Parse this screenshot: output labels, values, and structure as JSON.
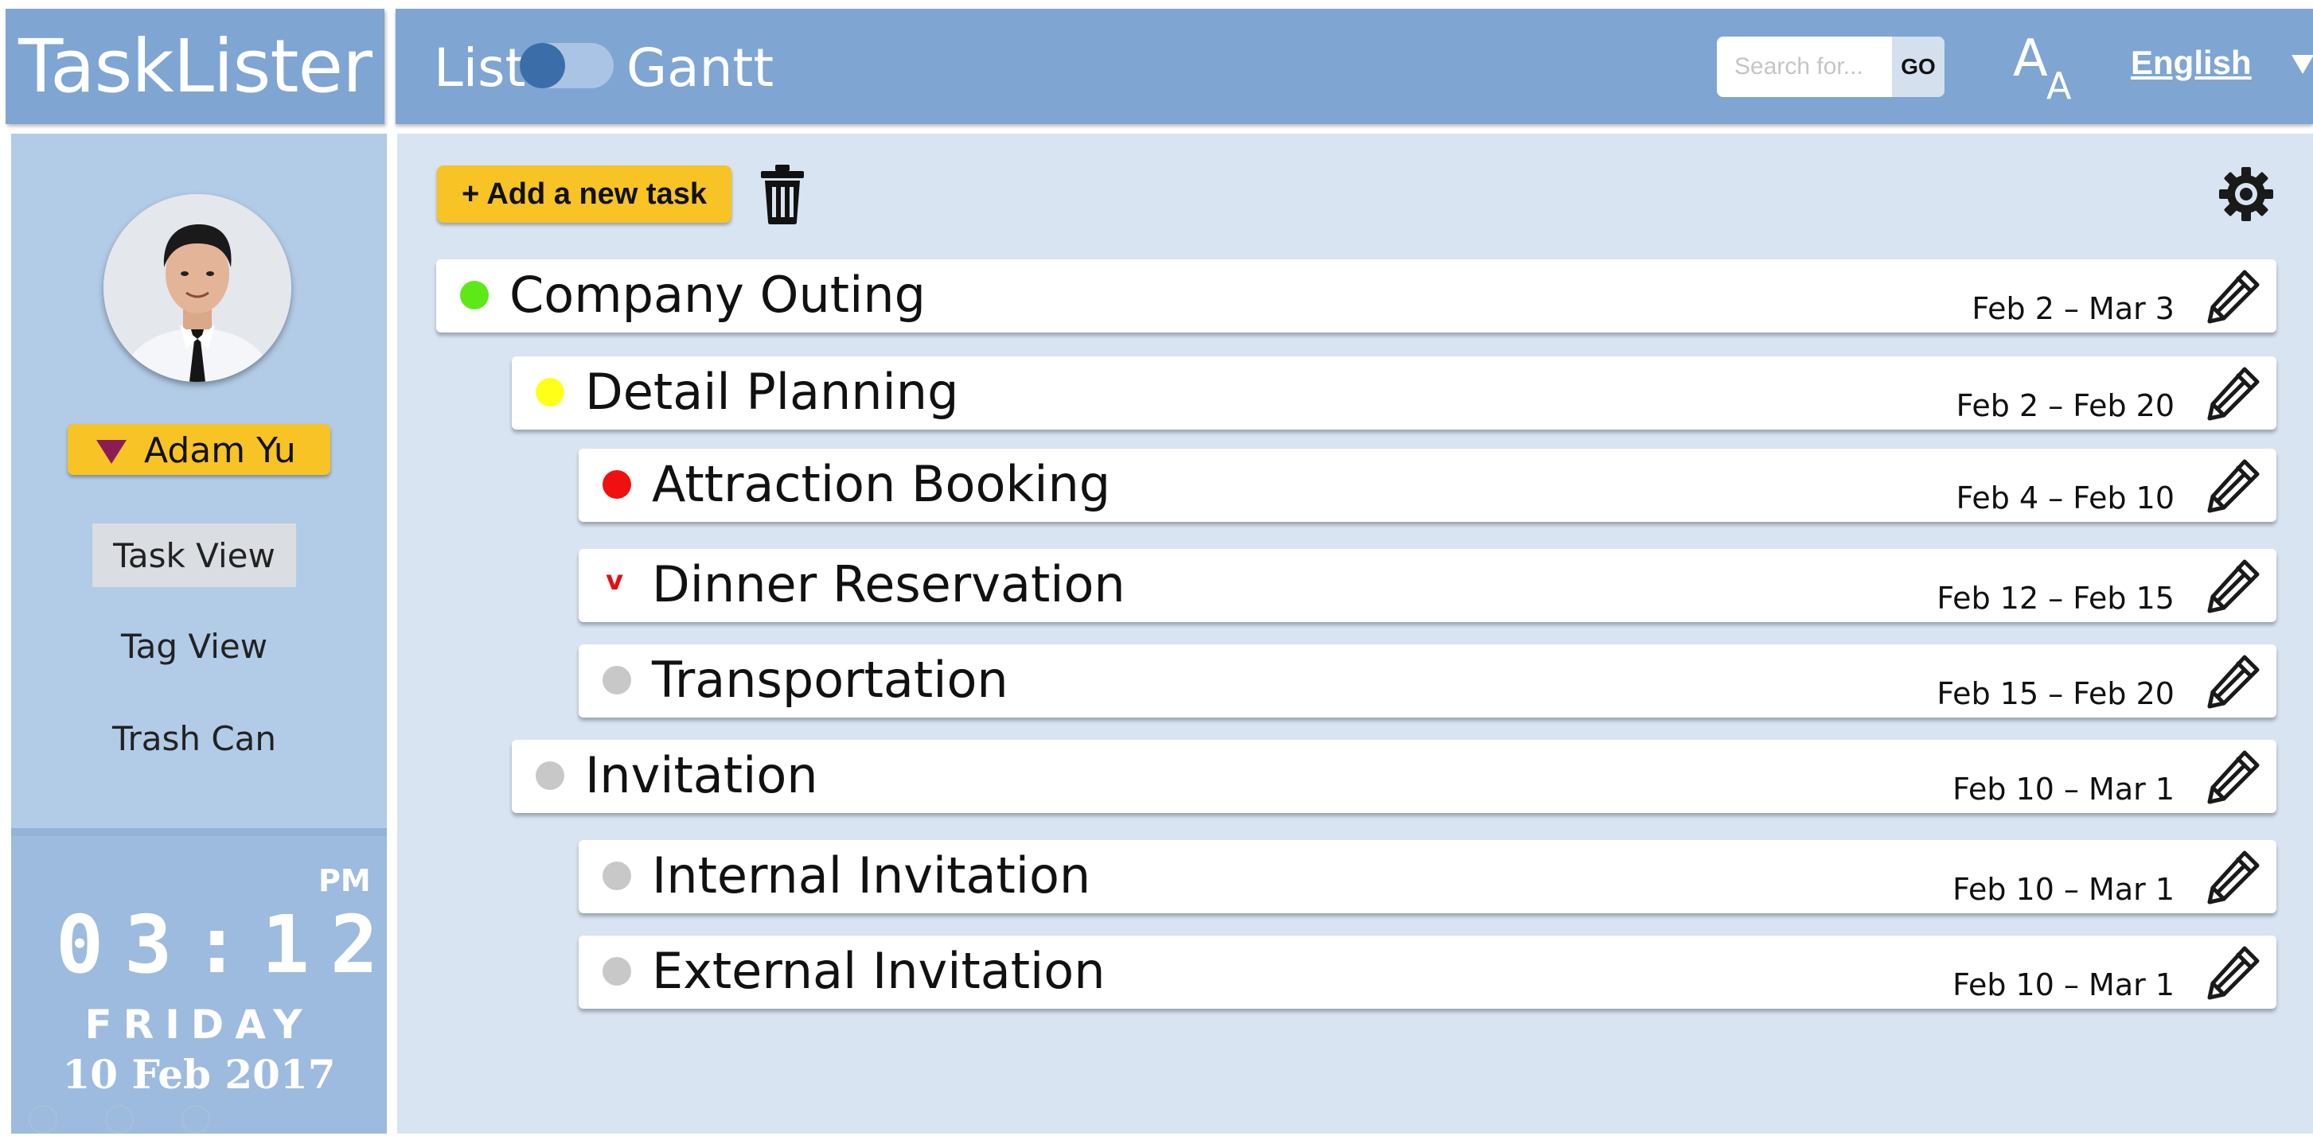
{
  "app": {
    "title": "TaskLister"
  },
  "header": {
    "mode_list": "List",
    "mode_gantt": "Gantt",
    "search_placeholder": "Search for...",
    "search_value": "",
    "go_label": "GO",
    "font_big": "A",
    "font_small": "A",
    "language": "English"
  },
  "sidebar": {
    "user_name": "Adam Yu",
    "nav": [
      {
        "label": "Task View",
        "active": true
      },
      {
        "label": "Tag View",
        "active": false
      },
      {
        "label": "Trash Can",
        "active": false
      }
    ],
    "clock": {
      "ampm": "PM",
      "time": "03:12",
      "day": "FRIDAY",
      "date": "10 Feb 2017"
    }
  },
  "toolbar": {
    "add_label": "+ Add a new task"
  },
  "tasks": [
    {
      "title": "Company Outing",
      "dates": "Feb 2 – Mar 3",
      "status": "dot",
      "color": "#5fe817",
      "indent": 0
    },
    {
      "title": "Detail Planning",
      "dates": "Feb 2 – Feb 20",
      "status": "dot",
      "color": "#ffff1a",
      "indent": 1
    },
    {
      "title": "Attraction Booking",
      "dates": "Feb 4 – Feb 10",
      "status": "dot",
      "color": "#f01010",
      "indent": 2
    },
    {
      "title": "Dinner Reservation",
      "dates": "Feb 12 – Feb 15",
      "status": "chevron",
      "color": "#e21111",
      "indent": 2
    },
    {
      "title": "Transportation",
      "dates": "Feb 15 – Feb 20",
      "status": "dot",
      "color": "#c8c8c8",
      "indent": 2
    },
    {
      "title": "Invitation",
      "dates": "Feb 10 – Mar 1",
      "status": "dot",
      "color": "#c8c8c8",
      "indent": 1
    },
    {
      "title": "Internal Invitation",
      "dates": "Feb 10 – Mar 1",
      "status": "dot",
      "color": "#c8c8c8",
      "indent": 2
    },
    {
      "title": "External Invitation",
      "dates": "Feb 10 – Mar 1",
      "status": "dot",
      "color": "#c8c8c8",
      "indent": 2
    }
  ],
  "colors": {
    "header_bg": "#7fa5d2",
    "sidebar_bg": "#b2cbe6",
    "main_bg": "#d9e4f2",
    "accent_yellow": "#f7c325"
  }
}
